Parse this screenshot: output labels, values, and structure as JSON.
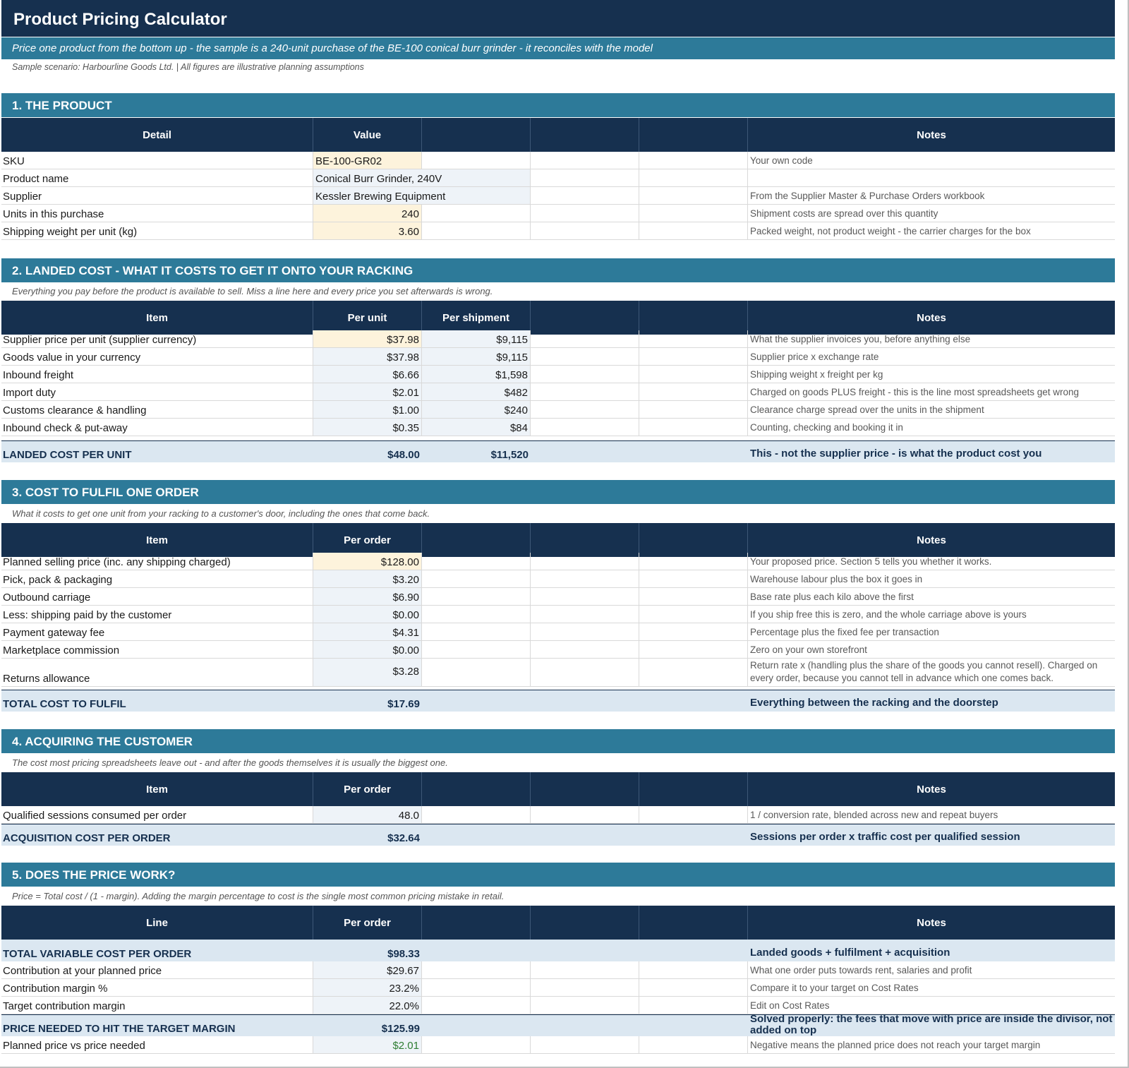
{
  "title": "Product Pricing Calculator",
  "subtitle": "Price one product from the bottom up - the sample is a 240-unit purchase of the BE-100 conical burr grinder - it reconciles with the model",
  "scenario": "Sample scenario: Harbourline Goods Ltd.   |   All figures are illustrative planning assumptions",
  "colors": {
    "navy": "#16304f",
    "teal": "#2d7a99",
    "input": "#fdf3dc",
    "total": "#dbe7f1",
    "positive": "#2e7d32"
  },
  "s1": {
    "title": "1. THE PRODUCT",
    "headers": [
      "Detail",
      "Value",
      "Notes"
    ],
    "rows": [
      {
        "label": "SKU",
        "value": "BE-100-GR02",
        "note": "Your own code"
      },
      {
        "label": "Product name",
        "value": "Conical Burr Grinder, 240V",
        "note": ""
      },
      {
        "label": "Supplier",
        "value": "Kessler Brewing Equipment",
        "note": "From the Supplier Master & Purchase Orders workbook"
      },
      {
        "label": "Units in this purchase",
        "value": "240",
        "note": "Shipment costs are spread over this quantity"
      },
      {
        "label": "Shipping weight per unit (kg)",
        "value": "3.60",
        "note": "Packed weight, not product weight - the carrier charges for the box"
      }
    ]
  },
  "s2": {
    "title": "2. LANDED COST - WHAT IT COSTS TO GET IT ONTO YOUR RACKING",
    "note": "Everything you pay before the product is available to sell. Miss a line here and every price you set afterwards is wrong.",
    "headers": [
      "Item",
      "Per unit",
      "Per shipment",
      "Notes"
    ],
    "rows": [
      {
        "label": "Supplier price per unit (supplier currency)",
        "unit": "$37.98",
        "ship": "$9,115",
        "note": "What the supplier invoices you, before anything else"
      },
      {
        "label": "Goods value in your currency",
        "unit": "$37.98",
        "ship": "$9,115",
        "note": "Supplier price x exchange rate"
      },
      {
        "label": "Inbound freight",
        "unit": "$6.66",
        "ship": "$1,598",
        "note": "Shipping weight x freight per kg"
      },
      {
        "label": "Import duty",
        "unit": "$2.01",
        "ship": "$482",
        "note": "Charged on goods PLUS freight - this is the line most spreadsheets get wrong"
      },
      {
        "label": "Customs clearance & handling",
        "unit": "$1.00",
        "ship": "$240",
        "note": "Clearance charge spread over the units in the shipment"
      },
      {
        "label": "Inbound check & put-away",
        "unit": "$0.35",
        "ship": "$84",
        "note": "Counting, checking and booking it in"
      }
    ],
    "total": {
      "label": "LANDED COST PER UNIT",
      "unit": "$48.00",
      "ship": "$11,520",
      "note": "This - not the supplier price - is what the product cost you"
    }
  },
  "s3": {
    "title": "3. COST TO FULFIL ONE ORDER",
    "note": "What it costs to get one unit from your racking to a customer's door, including the ones that come back.",
    "headers": [
      "Item",
      "Per order",
      "Notes"
    ],
    "rows": [
      {
        "label": "Planned selling price (inc. any shipping charged)",
        "value": "$128.00",
        "note": "Your proposed price. Section 5 tells you whether it works."
      },
      {
        "label": "Pick, pack & packaging",
        "value": "$3.20",
        "note": "Warehouse labour plus the box it goes in"
      },
      {
        "label": "Outbound carriage",
        "value": "$6.90",
        "note": "Base rate plus each kilo above the first"
      },
      {
        "label": "Less: shipping paid by the customer",
        "value": "$0.00",
        "note": "If you ship free this is zero, and the whole carriage above is yours"
      },
      {
        "label": "Payment gateway fee",
        "value": "$4.31",
        "note": "Percentage plus the fixed fee per transaction"
      },
      {
        "label": "Marketplace commission",
        "value": "$0.00",
        "note": "Zero on your own storefront"
      },
      {
        "label": "Returns allowance",
        "value": "$3.28",
        "note": "Return rate x (handling plus the share of the goods you cannot resell). Charged on every order, because you cannot tell in advance which one comes back."
      }
    ],
    "total": {
      "label": "TOTAL COST TO FULFIL",
      "value": "$17.69",
      "note": "Everything between the racking and the doorstep"
    }
  },
  "s4": {
    "title": "4. ACQUIRING THE CUSTOMER",
    "note": "The cost most pricing spreadsheets leave out - and after the goods themselves it is usually the biggest one.",
    "headers": [
      "Item",
      "Per order",
      "Notes"
    ],
    "rows": [
      {
        "label": "Qualified sessions consumed per order",
        "value": "48.0",
        "note": "1 / conversion rate, blended across new and repeat buyers"
      }
    ],
    "total": {
      "label": "ACQUISITION COST PER ORDER",
      "value": "$32.64",
      "note": "Sessions per order x traffic cost per qualified session"
    }
  },
  "s5": {
    "title": "5. DOES THE PRICE WORK?",
    "note": "Price = Total cost / (1 - margin). Adding the margin percentage to cost is the single most common pricing mistake in retail.",
    "headers": [
      "Line",
      "Per order",
      "Notes"
    ],
    "total_top": {
      "label": "TOTAL VARIABLE COST PER ORDER",
      "value": "$98.33",
      "note": "Landed goods + fulfilment + acquisition"
    },
    "rows": [
      {
        "label": "Contribution at your planned price",
        "value": "$29.67",
        "note": "What one order puts towards rent, salaries and profit"
      },
      {
        "label": "Contribution margin %",
        "value": "23.2%",
        "note": "Compare it to your target on Cost Rates"
      },
      {
        "label": "Target contribution margin",
        "value": "22.0%",
        "note": "Edit on Cost Rates"
      }
    ],
    "total_mid": {
      "label": "PRICE NEEDED TO HIT THE TARGET MARGIN",
      "value": "$125.99",
      "note": "Solved properly: the fees that move with price are inside the divisor, not added on top"
    },
    "last": {
      "label": "Planned price vs price needed",
      "value": "$2.01",
      "note": "Negative means the planned price does not reach your target margin"
    }
  }
}
